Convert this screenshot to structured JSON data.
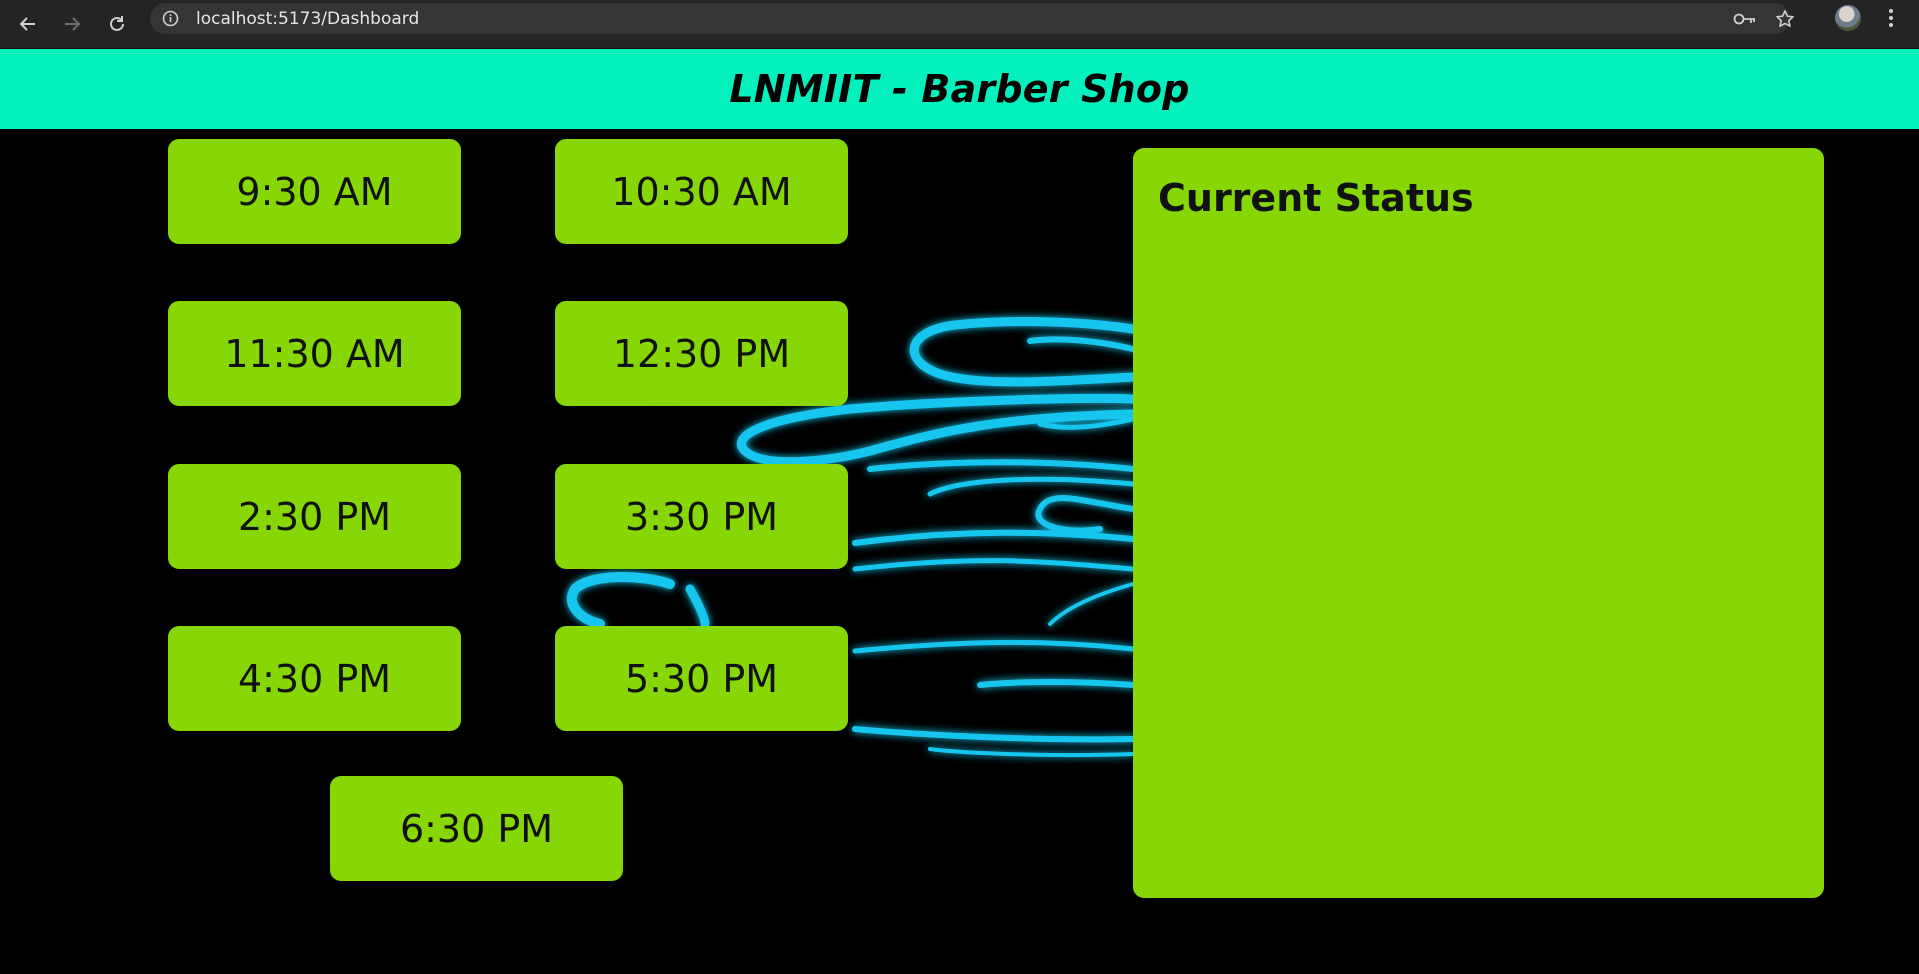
{
  "browser": {
    "url": "localhost:5173/Dashboard"
  },
  "header": {
    "title": "LNMIIT - Barber Shop"
  },
  "slots": [
    "9:30 AM",
    "10:30 AM",
    "11:30 AM",
    "12:30 PM",
    "2:30 PM",
    "3:30 PM",
    "4:30 PM",
    "5:30 PM",
    "6:30 PM"
  ],
  "status": {
    "title": "Current Status"
  },
  "colors": {
    "header_bg": "#04f0bd",
    "slot_bg": "#86d705",
    "neon": "#19c6ee"
  }
}
